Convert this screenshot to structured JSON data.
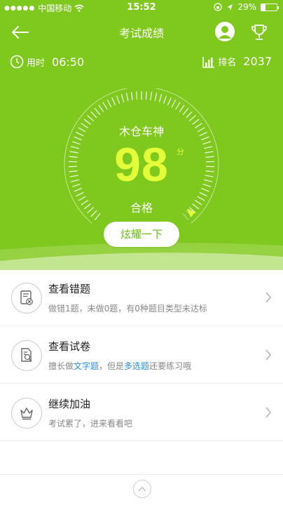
{
  "statusbar": {
    "carrier": "中国移动",
    "time": "15:52",
    "battery": "29%",
    "battery_level": 0.29
  },
  "navbar": {
    "title": "考试成绩",
    "back_icon": "back-arrow-icon",
    "avatar_icon": "user-avatar-icon",
    "trophy_icon": "trophy-icon"
  },
  "info": {
    "time_label": "用时",
    "time_value": "06:50",
    "rank_label": "排名",
    "rank_value": "2037"
  },
  "result": {
    "nickname": "木仓车神",
    "score": "98",
    "score_unit": "分",
    "grade": "合格",
    "gauge_fraction": 0.98
  },
  "share_button": "炫耀一下",
  "actions": [
    {
      "title": "查看错题",
      "desc": "做错1题，未做0题，有0种题目类型未达标"
    },
    {
      "title": "查看试卷",
      "desc_parts": [
        "擅长做",
        "文字题",
        "，但是",
        "多选题",
        "还要练习哦"
      ]
    },
    {
      "title": "继续加油",
      "desc": "考试累了，进来看看吧"
    }
  ],
  "colors": {
    "hero_green": "#7fc81e",
    "score_yellow": "#e3ff3a",
    "link_blue": "#2b8fe0"
  }
}
